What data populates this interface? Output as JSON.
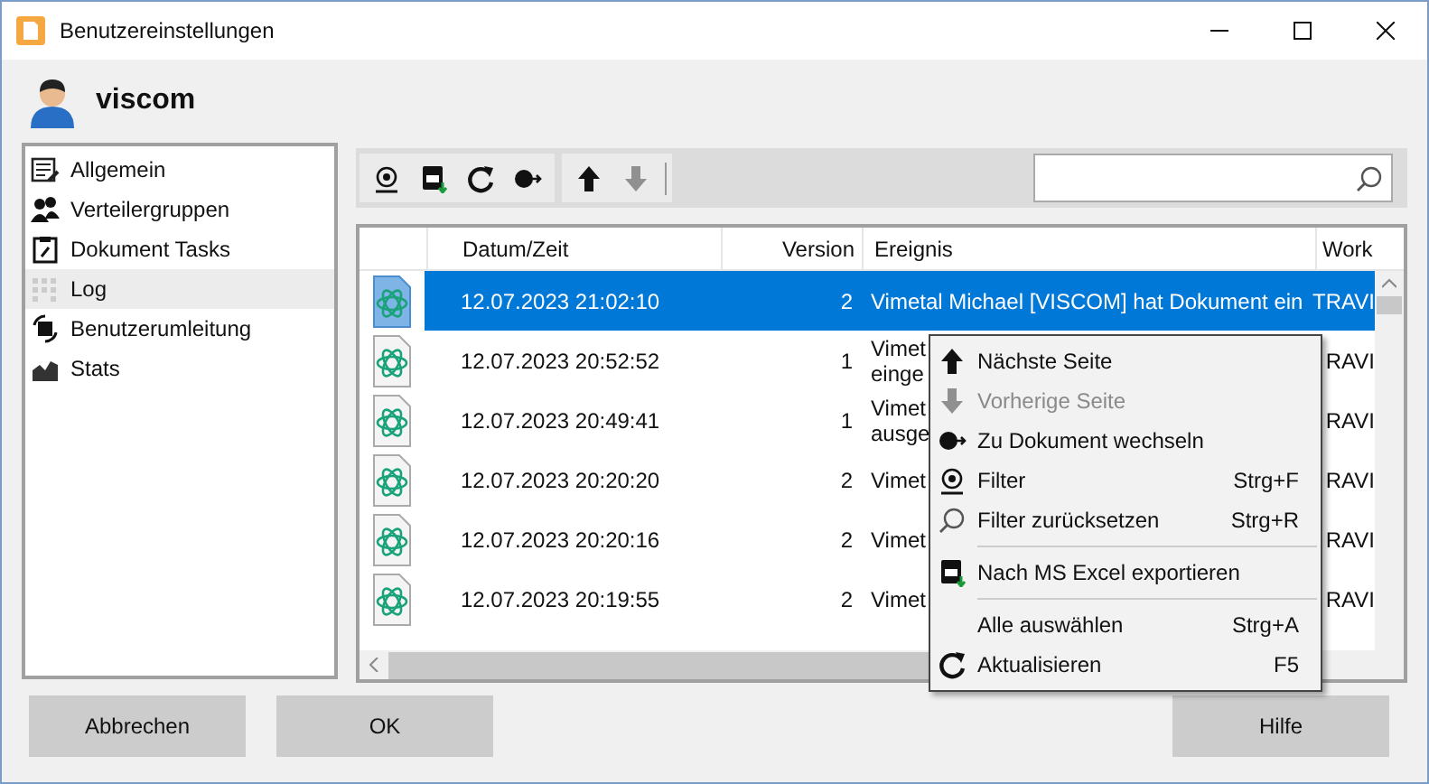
{
  "window": {
    "title": "Benutzereinstellungen"
  },
  "user": {
    "name": "viscom"
  },
  "sidebar": {
    "items": [
      {
        "label": "Allgemein",
        "selected": false
      },
      {
        "label": "Verteilergruppen",
        "selected": false
      },
      {
        "label": "Dokument Tasks",
        "selected": false
      },
      {
        "label": "Log",
        "selected": true
      },
      {
        "label": "Benutzerumleitung",
        "selected": false
      },
      {
        "label": "Stats",
        "selected": false
      }
    ]
  },
  "toolbar": {
    "groups": [
      [
        {
          "disabled": false
        },
        {
          "disabled": false
        },
        {
          "disabled": false
        },
        {
          "disabled": false
        }
      ],
      [
        {
          "disabled": false
        },
        {
          "disabled": true
        }
      ]
    ]
  },
  "table": {
    "columns": [
      "Datum/Zeit",
      "Version",
      "Ereignis",
      "Work"
    ],
    "rows": [
      {
        "datetime": "12.07.2023 21:02:10",
        "version": "2",
        "event": [
          "Vimetal Michael [VISCOM] hat Dokument ein"
        ],
        "work": "TRAVI",
        "selected": true
      },
      {
        "datetime": "12.07.2023 20:52:52",
        "version": "1",
        "event": [
          "Vimet",
          "einge"
        ],
        "work": "RAVI",
        "selected": false
      },
      {
        "datetime": "12.07.2023 20:49:41",
        "version": "1",
        "event": [
          "Vimet",
          "ausge"
        ],
        "work": "RAVI",
        "selected": false
      },
      {
        "datetime": "12.07.2023 20:20:20",
        "version": "2",
        "event": [
          "Vimet"
        ],
        "work": "RAVI",
        "selected": false
      },
      {
        "datetime": "12.07.2023 20:20:16",
        "version": "2",
        "event": [
          "Vimet"
        ],
        "work": "RAVI",
        "selected": false
      },
      {
        "datetime": "12.07.2023 20:19:55",
        "version": "2",
        "event": [
          "Vimet"
        ],
        "work": "RAVI",
        "selected": false
      }
    ]
  },
  "context_menu": {
    "items": [
      {
        "kind": "item",
        "label": "Nächste Seite",
        "disabled": false
      },
      {
        "kind": "item",
        "label": "Vorherige Seite",
        "disabled": true
      },
      {
        "kind": "item",
        "label": "Zu Dokument wechseln",
        "disabled": false
      },
      {
        "kind": "item",
        "label": "Filter",
        "shortcut": "Strg+F",
        "disabled": false
      },
      {
        "kind": "item",
        "label": "Filter zurücksetzen",
        "shortcut": "Strg+R",
        "disabled": false
      },
      {
        "kind": "separator"
      },
      {
        "kind": "item",
        "label": "Nach MS Excel exportieren",
        "disabled": false
      },
      {
        "kind": "separator"
      },
      {
        "kind": "item",
        "label": "Alle auswählen",
        "shortcut": "Strg+A",
        "disabled": false
      },
      {
        "kind": "item",
        "label": "Aktualisieren",
        "shortcut": "F5",
        "disabled": false
      }
    ]
  },
  "buttons": {
    "left": [
      "Abbrechen",
      "OK"
    ],
    "right": [
      "Hilfe"
    ]
  }
}
